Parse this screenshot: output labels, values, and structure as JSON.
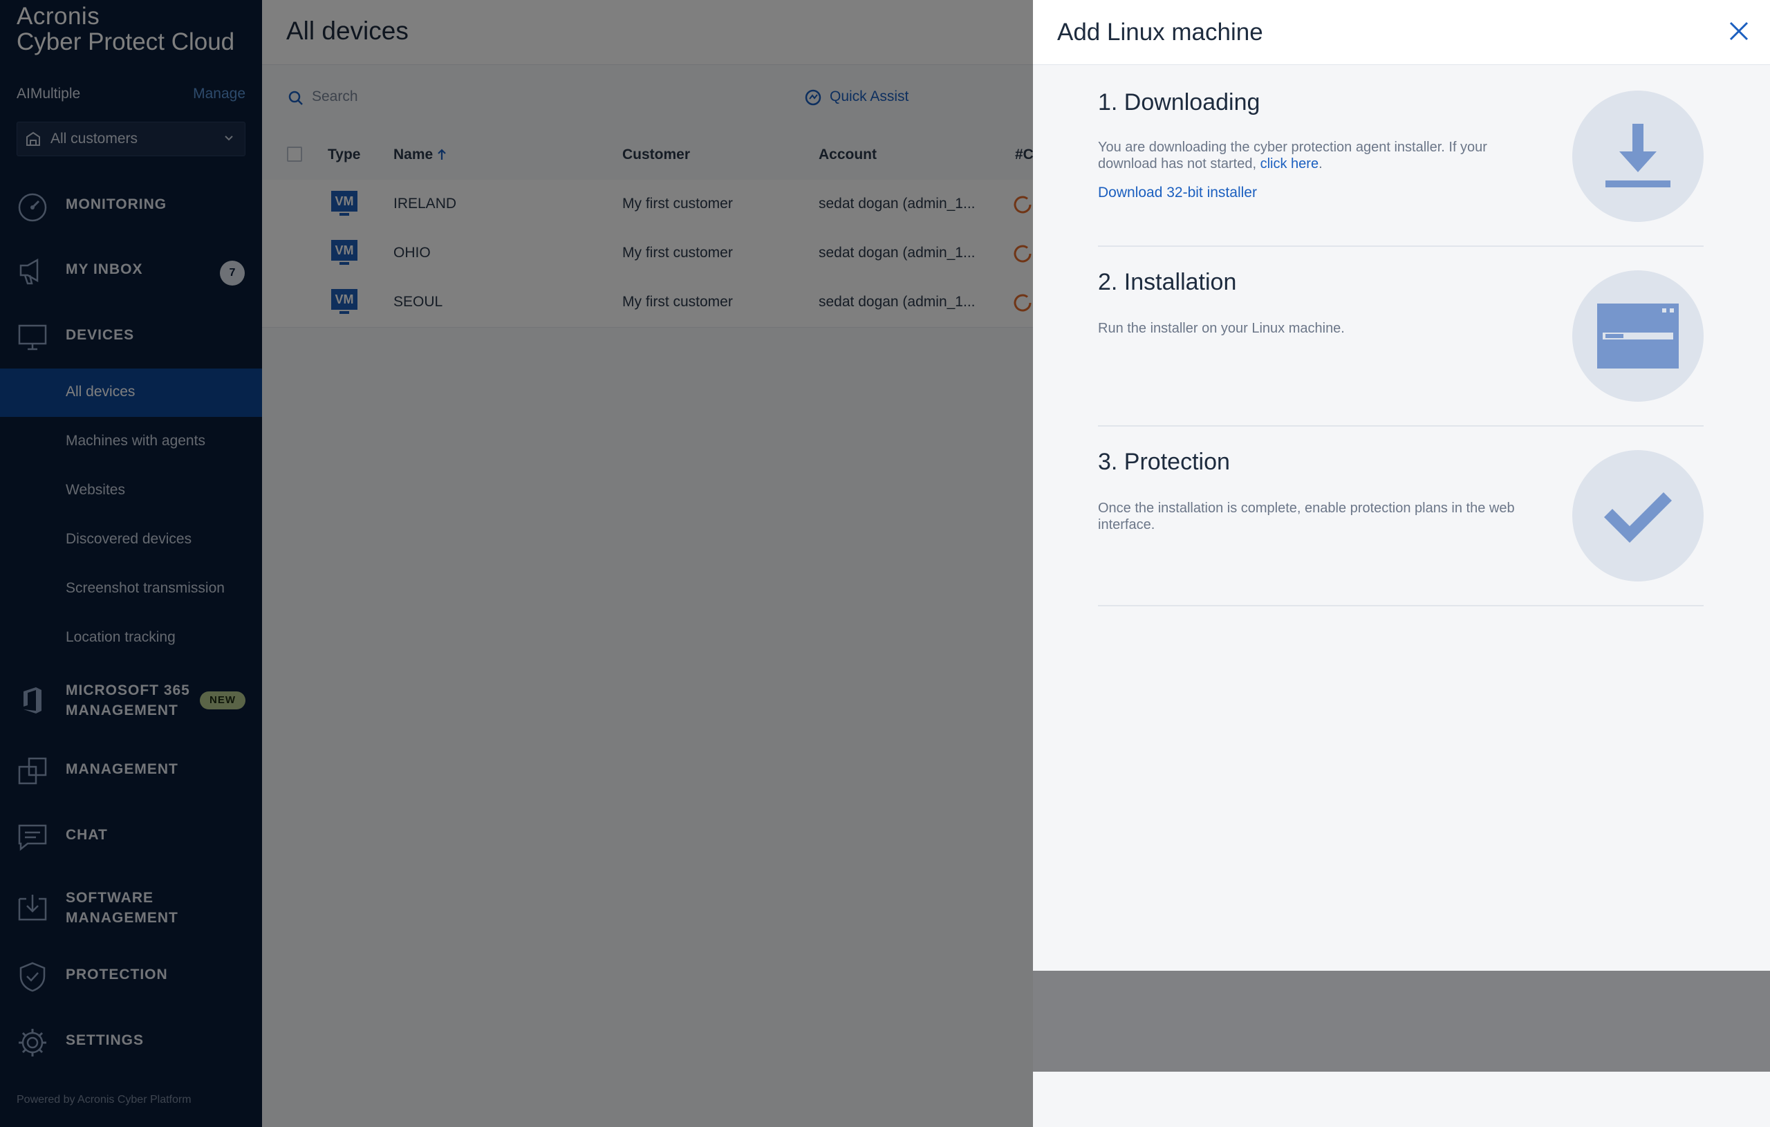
{
  "brand": {
    "line1": "Acronis",
    "line2": "Cyber Protect Cloud"
  },
  "tenant": {
    "name": "AIMultiple",
    "manage_label": "Manage"
  },
  "customer_select": {
    "value": "All customers"
  },
  "nav": {
    "monitoring": "MONITORING",
    "inbox": "MY INBOX",
    "inbox_count": "7",
    "devices": "DEVICES",
    "m365_line1": "MICROSOFT 365",
    "m365_line2": "MANAGEMENT",
    "m365_badge": "NEW",
    "management": "MANAGEMENT",
    "chat": "CHAT",
    "software_line1": "SOFTWARE",
    "software_line2": "MANAGEMENT",
    "protection": "PROTECTION",
    "settings": "SETTINGS"
  },
  "devices_sub": [
    "All devices",
    "Machines with agents",
    "Websites",
    "Discovered devices",
    "Screenshot transmission",
    "Location tracking"
  ],
  "footer": "Powered by Acronis Cyber Platform",
  "main": {
    "title": "All devices",
    "search_placeholder": "Search",
    "quick_assist": "Quick Assist",
    "columns": {
      "type": "Type",
      "name": "Name",
      "customer": "Customer",
      "account": "Account",
      "extra": "#C"
    },
    "rows": [
      {
        "type": "VM",
        "name": "IRELAND",
        "customer": "My first customer",
        "account": "sedat dogan (admin_1..."
      },
      {
        "type": "VM",
        "name": "OHIO",
        "customer": "My first customer",
        "account": "sedat dogan (admin_1..."
      },
      {
        "type": "VM",
        "name": "SEOUL",
        "customer": "My first customer",
        "account": "sedat dogan (admin_1..."
      }
    ]
  },
  "panel": {
    "title": "Add Linux machine",
    "steps": [
      {
        "title": "1. Downloading",
        "desc_pre": "You are downloading the cyber protection agent installer. If your download has not started, ",
        "desc_link": "click here",
        "desc_post": ".",
        "link": "Download 32-bit installer",
        "icon": "download-icon"
      },
      {
        "title": "2. Installation",
        "desc": "Run the installer on your Linux machine.",
        "icon": "window-icon"
      },
      {
        "title": "3. Protection",
        "desc": "Once the installation is complete, enable protection plans in the web interface.",
        "icon": "checkmark-icon"
      }
    ]
  },
  "colors": {
    "sidebar_bg": "#0b1d39",
    "sidebar_active": "#0d4697",
    "accent_link": "#1b5fbf",
    "icon_blue": "#7696cc",
    "circle_bg": "#dde3ec",
    "spinner": "#e06a2c"
  }
}
